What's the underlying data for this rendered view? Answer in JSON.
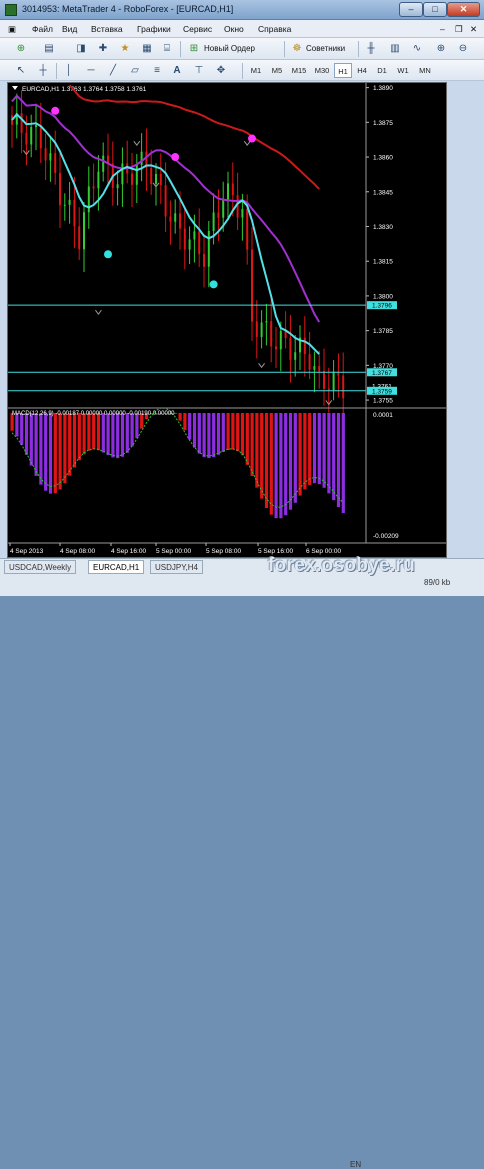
{
  "window": {
    "title": "3014953: MetaTrader 4 - RoboForex - [EURCAD,H1]"
  },
  "menu": [
    "Файл",
    "Вид",
    "Вставка",
    "Графики",
    "Сервис",
    "Окно",
    "Справка"
  ],
  "toolbar": {
    "new_order_label": "Новый Ордер",
    "advisors_label": "Советники"
  },
  "timeframes": [
    "M1",
    "M5",
    "M15",
    "M30",
    "H1",
    "H4",
    "D1",
    "W1",
    "MN"
  ],
  "active_timeframe": "H1",
  "tabs": [
    "USDCAD,Weekly",
    "EURCAD,H1",
    "USDJPY,H4"
  ],
  "active_tab": "EURCAD,H1",
  "status": {
    "traffic": "89/0 kb",
    "lang": "EN",
    "watermark": "forex.osobye.ru"
  },
  "chart_data": {
    "type": "candlestick",
    "symbol_line": "EURCAD,H1  1.3763 1.3764 1.3758 1.3761",
    "price_ticks": [
      "1.3890",
      "1.3875",
      "1.3860",
      "1.3845",
      "1.3830",
      "1.3815",
      "1.3800",
      "1.3785",
      "1.3770",
      "1.3755"
    ],
    "price_levels": [
      {
        "label": "1.3796",
        "color": "#40e0e0"
      },
      {
        "label": "1.3767",
        "color": "#40e0e0"
      },
      {
        "label": "1.3761",
        "color": "#ffffff"
      },
      {
        "label": "1.3759",
        "color": "#40e0e0"
      }
    ],
    "time_labels": [
      "4 Sep 2013",
      "4 Sep 08:00",
      "4 Sep 16:00",
      "5 Sep 00:00",
      "5 Sep 08:00",
      "5 Sep 16:00",
      "6 Sep 00:00"
    ],
    "ma_colors": {
      "slow": "#cc1a1a",
      "mid": "#a030d0",
      "fast": "#55e0e8"
    },
    "macd_label": "MACD(12,26,9) -0.00187 0.00000 0.00000 -0.00190 0.00000",
    "macd_ticks": [
      "0.0001",
      "-0.00209"
    ],
    "macd_colors": {
      "bear": "#e01414",
      "bull": "#8c2ee0",
      "signal": "#30c030"
    }
  }
}
